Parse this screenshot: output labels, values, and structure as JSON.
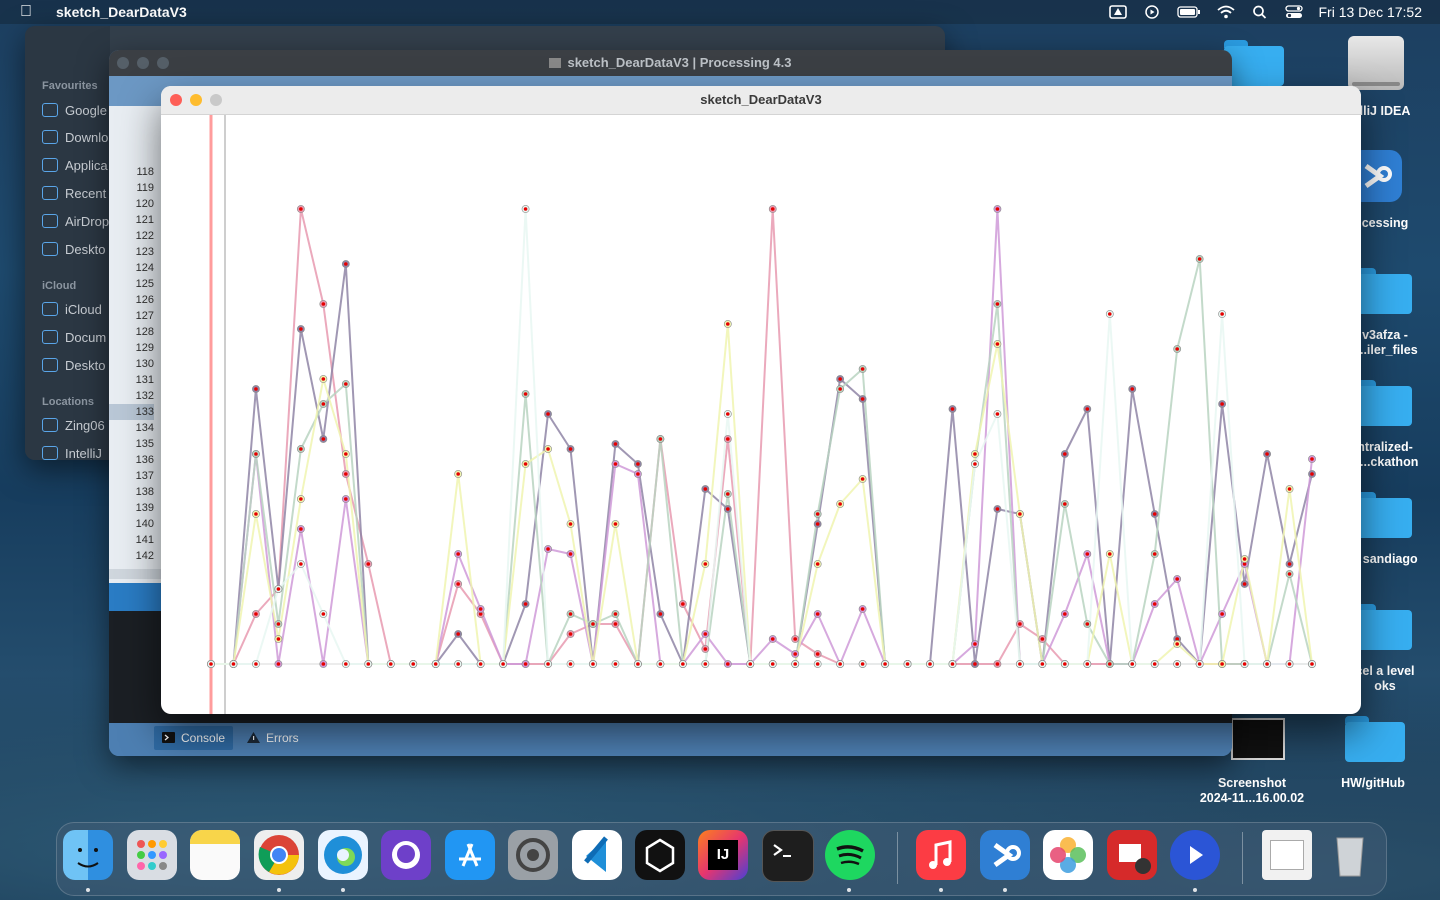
{
  "menubar": {
    "app_name": "sketch_DearDataV3",
    "clock": "Fri 13 Dec  17:52"
  },
  "desktop": {
    "items": [
      {
        "label": "lliJ IDEA"
      },
      {
        "label": "cessing"
      },
      {
        "label": "v3afza -\n-...iler_files"
      },
      {
        "label": "ntralized-\nS...ckathon"
      },
      {
        "label": "a sandiago"
      },
      {
        "label": "cel a level\noks"
      },
      {
        "label": "HW/gitHub"
      },
      {
        "label": "Screenshot\n2024-11...16.00.02"
      }
    ]
  },
  "finder": {
    "sections": [
      "Favourites",
      "iCloud",
      "Locations"
    ],
    "items": [
      "Google",
      "Downlo",
      "Applica",
      "Recent",
      "AirDrop",
      "Deskto",
      "iCloud",
      "Docum",
      "Deskto",
      "Zing06",
      "IntelliJ"
    ]
  },
  "ide": {
    "title": "sketch_DearDataV3 | Processing 4.3",
    "line_numbers": [
      "118",
      "119",
      "120",
      "121",
      "122",
      "123",
      "124",
      "125",
      "126",
      "127",
      "128",
      "129",
      "130",
      "131",
      "132",
      "133",
      "134",
      "135",
      "136",
      "137",
      "138",
      "139",
      "140",
      "141",
      "142"
    ],
    "tabs": {
      "console": "Console",
      "errors": "Errors"
    }
  },
  "sketch": {
    "title": "sketch_DearDataV3"
  },
  "chart_data": {
    "type": "line",
    "x": [
      0,
      1,
      2,
      3,
      4,
      5,
      6,
      7,
      8,
      9,
      10,
      11,
      12,
      13,
      14,
      15,
      16,
      17,
      18,
      19,
      20,
      21,
      22,
      23,
      24,
      25,
      26,
      27,
      28,
      29,
      30,
      31,
      32,
      33,
      34,
      35,
      36,
      37,
      38,
      39,
      40,
      41,
      42,
      43,
      44,
      45,
      46,
      47,
      48,
      49
    ],
    "ylim": [
      0,
      100
    ],
    "series": [
      {
        "color": "#e79ab0",
        "values": [
          0,
          0,
          10,
          15,
          91,
          72,
          38,
          20,
          0,
          0,
          0,
          16,
          10,
          0,
          0,
          0,
          6,
          8,
          8,
          0,
          45,
          12,
          3,
          45,
          0,
          91,
          5,
          2,
          0,
          0,
          0,
          0,
          0,
          0,
          0,
          0,
          8,
          5,
          0,
          0,
          0,
          0,
          0,
          0,
          0,
          0,
          0,
          0,
          0,
          0
        ]
      },
      {
        "color": "#8f85a6",
        "values": [
          0,
          0,
          55,
          15,
          67,
          45,
          80,
          0,
          0,
          0,
          0,
          6,
          0,
          0,
          12,
          50,
          43,
          0,
          44,
          40,
          10,
          0,
          35,
          31,
          0,
          0,
          0,
          28,
          57,
          53,
          0,
          0,
          0,
          51,
          0,
          31,
          30,
          0,
          42,
          51,
          0,
          55,
          30,
          5,
          0,
          52,
          16,
          42,
          20,
          38
        ]
      },
      {
        "color": "#cf9ad8",
        "values": [
          0,
          0,
          42,
          0,
          27,
          0,
          33,
          0,
          0,
          0,
          0,
          22,
          11,
          0,
          0,
          23,
          22,
          0,
          40,
          38,
          0,
          0,
          6,
          0,
          0,
          5,
          2,
          10,
          0,
          11,
          0,
          0,
          0,
          0,
          4,
          91,
          0,
          0,
          10,
          22,
          0,
          0,
          12,
          17,
          0,
          10,
          20,
          0,
          0,
          41
        ]
      },
      {
        "color": "#b8d3c1",
        "values": [
          0,
          0,
          42,
          8,
          43,
          52,
          56,
          0,
          0,
          0,
          0,
          0,
          0,
          0,
          54,
          0,
          10,
          8,
          10,
          0,
          45,
          0,
          0,
          34,
          0,
          0,
          0,
          30,
          55,
          59,
          0,
          0,
          0,
          0,
          40,
          72,
          0,
          0,
          32,
          8,
          0,
          0,
          22,
          63,
          81,
          0,
          0,
          0,
          18,
          0
        ]
      },
      {
        "color": "#f0f4b0",
        "values": [
          0,
          0,
          30,
          5,
          33,
          57,
          42,
          0,
          0,
          0,
          0,
          38,
          0,
          0,
          40,
          43,
          28,
          0,
          28,
          0,
          0,
          0,
          20,
          68,
          0,
          0,
          0,
          20,
          32,
          37,
          0,
          0,
          0,
          0,
          42,
          64,
          30,
          0,
          0,
          0,
          22,
          0,
          0,
          4,
          0,
          0,
          21,
          0,
          35,
          0
        ]
      },
      {
        "color": "#e8f7f2",
        "values": [
          0,
          0,
          0,
          15,
          20,
          10,
          0,
          0,
          0,
          0,
          0,
          0,
          0,
          0,
          91,
          0,
          0,
          0,
          0,
          0,
          0,
          0,
          0,
          50,
          0,
          0,
          0,
          0,
          0,
          0,
          0,
          0,
          0,
          0,
          40,
          50,
          0,
          0,
          0,
          0,
          70,
          0,
          0,
          0,
          0,
          70,
          0,
          0,
          0,
          0
        ]
      }
    ]
  }
}
